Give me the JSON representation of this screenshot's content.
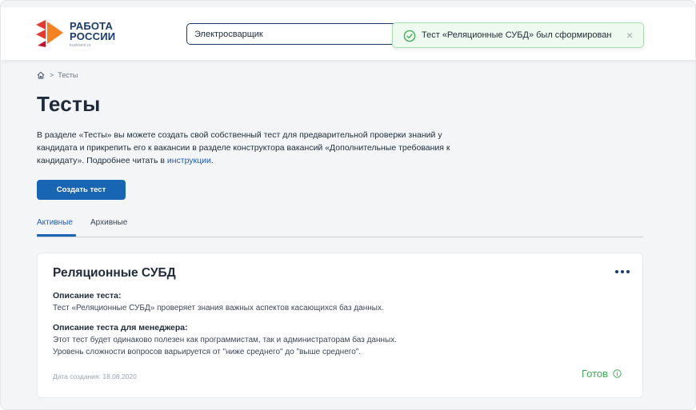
{
  "header": {
    "logo": {
      "line1": "РАБОТА",
      "line2": "РОССИИ",
      "site": "trudvsem.ru"
    },
    "search": {
      "value": "Электросварщик",
      "placeholder": ""
    },
    "toast": {
      "text": "Тест «Реляционные СУБД» был сформирован",
      "close": "×",
      "icon": "check-circle-icon"
    }
  },
  "breadcrumb": {
    "home_icon": "home-icon",
    "separator": ">",
    "current": "Тесты"
  },
  "page": {
    "title": "Тесты",
    "intro_text": "В разделе «Тесты» вы можете создать свой собственный тест для предварительной проверки знаний у кандидата и прикрепить его к вакансии в разделе конструктора вакансий «Дополнительные требования к кандидату». Подробнее читать в ",
    "intro_link": "инструкции",
    "intro_end": ".",
    "create_button": "Создать тест"
  },
  "tabs": {
    "active": "Активные",
    "archive": "Архивные"
  },
  "card": {
    "title": "Реляционные СУБД",
    "desc_label": "Описание теста:",
    "desc_text": "Тест «Реляционные СУБД» проверяет знания важных аспектов касающихся баз данных.",
    "mgr_label": "Описание теста для менеджера:",
    "mgr_line1": "Этот тест будет одинаково полезен как программистам, так и администраторам баз данных.",
    "mgr_line2": "Уровень сложности вопросов варьируется от \"ниже среднего\" до \"выше среднего\".",
    "date": "Дата создания: 18.08.2020",
    "status": "Готов",
    "status_icon": "info-icon",
    "menu_icon": "more-dots-icon"
  },
  "colors": {
    "brand_blue": "#1b3b6f",
    "button_blue": "#1865b4",
    "link_blue": "#1e5bb8",
    "success_green": "#3fae55",
    "logo_red": "#e8372c",
    "logo_orange": "#f58220"
  }
}
